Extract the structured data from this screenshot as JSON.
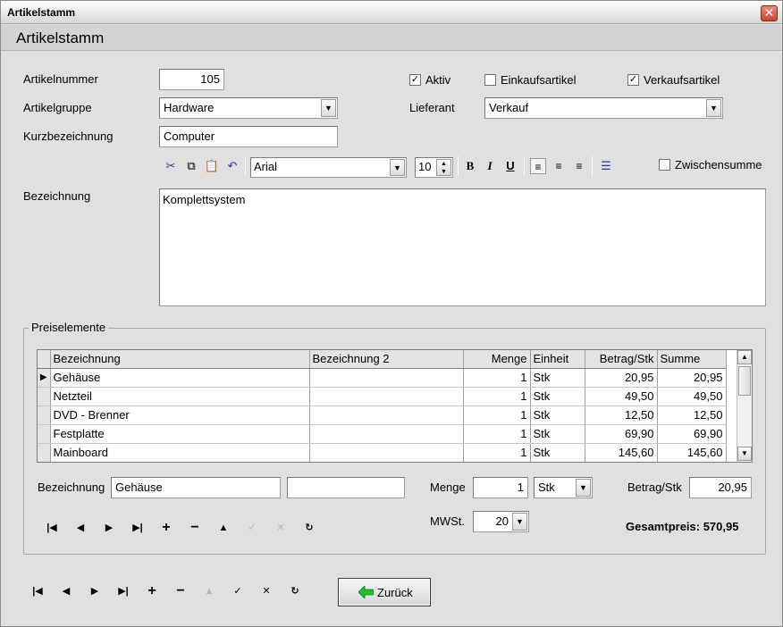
{
  "window": {
    "title": "Artikelstamm",
    "heading": "Artikelstamm"
  },
  "form": {
    "artikelnummer_label": "Artikelnummer",
    "artikelnummer": "105",
    "artikelgruppe_label": "Artikelgruppe",
    "artikelgruppe": "Hardware",
    "kurzbezeichnung_label": "Kurzbezeichnung",
    "kurzbezeichnung": "Computer",
    "aktiv_label": "Aktiv",
    "aktiv": true,
    "einkauf_label": "Einkaufsartikel",
    "einkauf": false,
    "verkauf_label": "Verkaufsartikel",
    "verkauf": true,
    "lieferant_label": "Lieferant",
    "lieferant": "Verkauf",
    "bezeichnung_label": "Bezeichnung",
    "bezeichnung_text": "Komplettsystem",
    "zwischensumme_label": "Zwischensumme",
    "zwischensumme": false
  },
  "toolbar": {
    "font": "Arial",
    "size": "10",
    "icons": [
      "cut-icon",
      "copy-icon",
      "paste-icon",
      "undo-icon",
      "bold-icon",
      "italic-icon",
      "underline-icon",
      "align-left-icon",
      "align-center-icon",
      "align-right-icon",
      "bullet-list-icon"
    ]
  },
  "preiselemente": {
    "title": "Preiselemente",
    "columns": [
      "Bezeichnung",
      "Bezeichnung 2",
      "Menge",
      "Einheit",
      "Betrag/Stk",
      "Summe"
    ],
    "rows": [
      {
        "bez": "Gehäuse",
        "bez2": "",
        "menge": "1",
        "einheit": "Stk",
        "betrag": "20,95",
        "summe": "20,95"
      },
      {
        "bez": "Netzteil",
        "bez2": "",
        "menge": "1",
        "einheit": "Stk",
        "betrag": "49,50",
        "summe": "49,50"
      },
      {
        "bez": "DVD - Brenner",
        "bez2": "",
        "menge": "1",
        "einheit": "Stk",
        "betrag": "12,50",
        "summe": "12,50"
      },
      {
        "bez": "Festplatte",
        "bez2": "",
        "menge": "1",
        "einheit": "Stk",
        "betrag": "69,90",
        "summe": "69,90"
      },
      {
        "bez": "Mainboard",
        "bez2": "",
        "menge": "1",
        "einheit": "Stk",
        "betrag": "145,60",
        "summe": "145,60"
      }
    ],
    "detail": {
      "bezeichnung_label": "Bezeichnung",
      "bezeichnung": "Gehäuse",
      "bezeichnung2": "",
      "menge_label": "Menge",
      "menge": "1",
      "einheit": "Stk",
      "betrag_label": "Betrag/Stk",
      "betrag": "20,95",
      "mwst_label": "MWSt.",
      "mwst": "20"
    },
    "gesamtpreis": "Gesamtpreis: 570,95"
  },
  "buttons": {
    "zurueck": "Zurück"
  }
}
